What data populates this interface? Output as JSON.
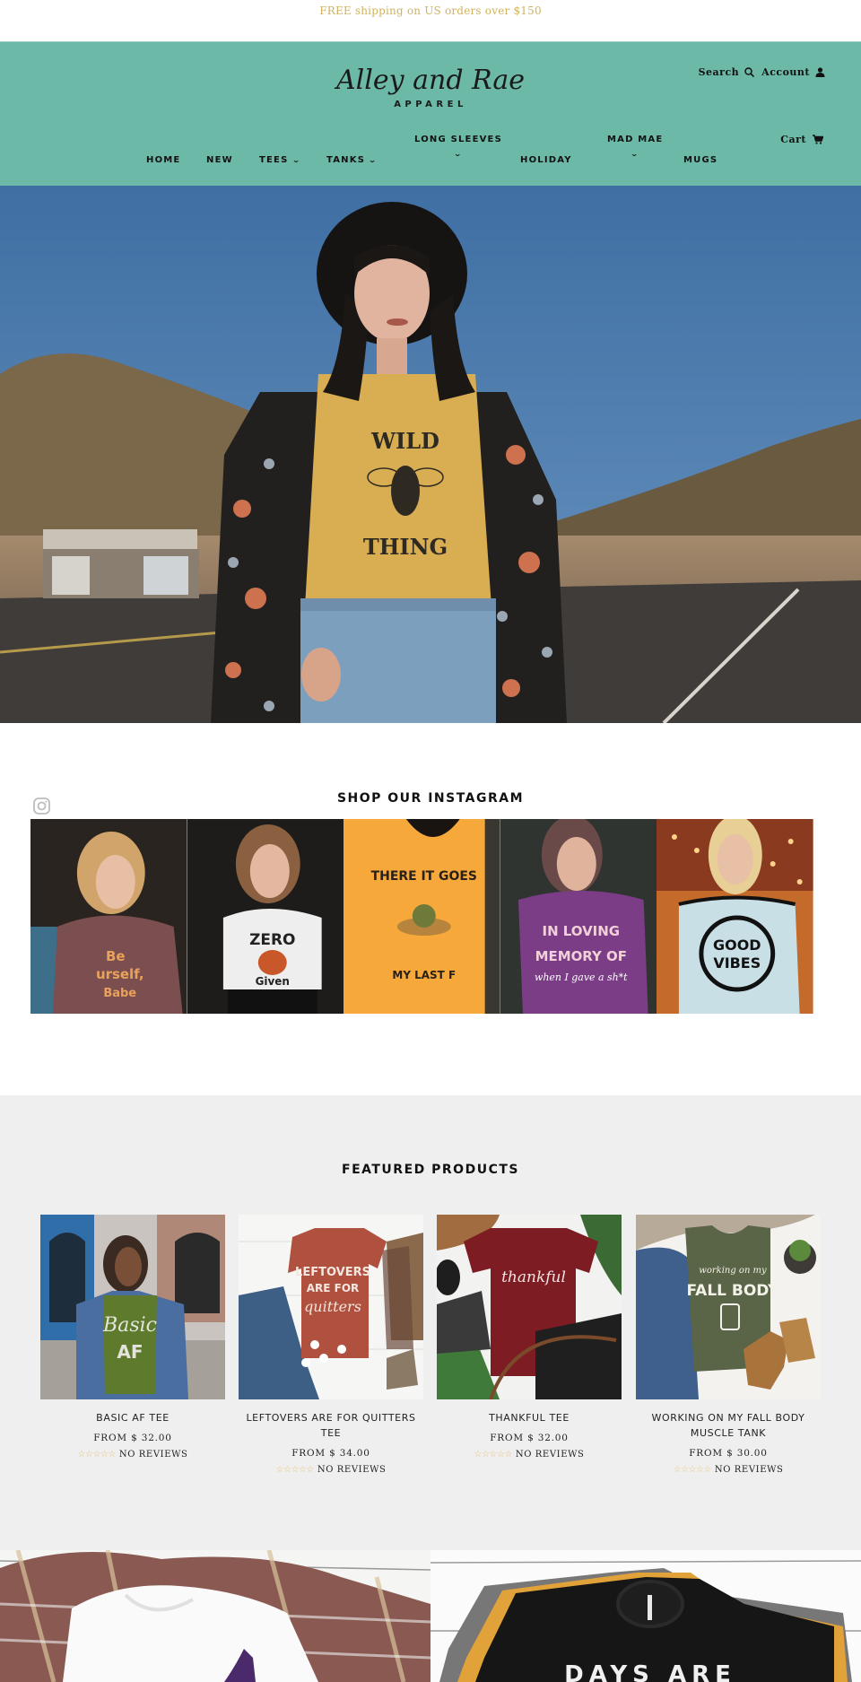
{
  "announcement": {
    "text": "FREE shipping on US orders over $150"
  },
  "brand": {
    "logo_script": "Alley and Rae",
    "logo_sub": "APPAREL",
    "header_color": "#6cb9a8",
    "accent_gold": "#cfb35e"
  },
  "header": {
    "search_label": "Search",
    "account_label": "Account",
    "cart_label": "Cart",
    "icons": {
      "search": "search-icon",
      "account": "user-icon",
      "cart": "cart-icon"
    }
  },
  "nav": {
    "items": [
      {
        "label": "HOME",
        "has_dropdown": false
      },
      {
        "label": "NEW",
        "has_dropdown": false
      },
      {
        "label": "TEES",
        "has_dropdown": true
      },
      {
        "label": "TANKS",
        "has_dropdown": true
      },
      {
        "label": "LONG SLEEVES",
        "has_dropdown": true
      },
      {
        "label": "HOLIDAY",
        "has_dropdown": false
      },
      {
        "label": "MAD MAE",
        "has_dropdown": true
      },
      {
        "label": "MUGS",
        "has_dropdown": false
      }
    ],
    "chevron": "⌄"
  },
  "hero": {
    "shirt_text_top": "WILD",
    "shirt_text_bottom": "THING",
    "alt": "Woman in black hat wearing yellow Wild Thing bee tee on a desert road"
  },
  "instagram": {
    "title": "SHOP OUR INSTAGRAM",
    "icon": "instagram-icon",
    "tiles": [
      {
        "caption": "Be Yourself Babe",
        "shirt_color": "#7b4e4f",
        "text_color": "#e8a25c"
      },
      {
        "caption": "ZERO Given",
        "shirt_color": "#eeeeee",
        "text_color": "#222222"
      },
      {
        "caption": "THERE IT GOES MY LAST F",
        "shirt_color": "#f6a93a",
        "text_color": "#2a2016"
      },
      {
        "caption": "IN LOVING MEMORY OF when I gave a sh*t",
        "shirt_color": "#7a3d86",
        "text_color": "#f2d0d8"
      },
      {
        "caption": "GOOD VIBES",
        "shirt_color": "#c8dfe6",
        "text_color": "#111111"
      }
    ]
  },
  "featured": {
    "title": "FEATURED PRODUCTS",
    "products": [
      {
        "name": "BASIC AF TEE",
        "price": "FROM $ 32.00",
        "reviews": "NO REVIEWS",
        "rating": 0,
        "shirt_text": "Basic AF",
        "shirt_color": "#5e7a2c"
      },
      {
        "name": "LEFTOVERS ARE FOR QUITTERS TEE",
        "price": "FROM $ 34.00",
        "reviews": "NO REVIEWS",
        "rating": 0,
        "shirt_text": "LEFTOVERS ARE FOR quitters",
        "shirt_color": "#b0503f"
      },
      {
        "name": "THANKFUL TEE",
        "price": "FROM $ 32.00",
        "reviews": "NO REVIEWS",
        "rating": 0,
        "shirt_text": "thankful",
        "shirt_color": "#7d1c22"
      },
      {
        "name": "WORKING ON MY FALL BODY MUSCLE TANK",
        "price": "FROM $ 30.00",
        "reviews": "NO REVIEWS",
        "rating": 0,
        "shirt_text": "working on my FALL BODY",
        "shirt_color": "#5a6446"
      }
    ],
    "star_glyphs": "☆☆☆☆☆",
    "star_color": "#e8c27a"
  },
  "banners": [
    {
      "alt": "White tee with purple witch hat on plaid scarf"
    },
    {
      "alt": "Black tee stacked on gray and mustard tees",
      "shirt_text": "DAYS ARE"
    }
  ]
}
